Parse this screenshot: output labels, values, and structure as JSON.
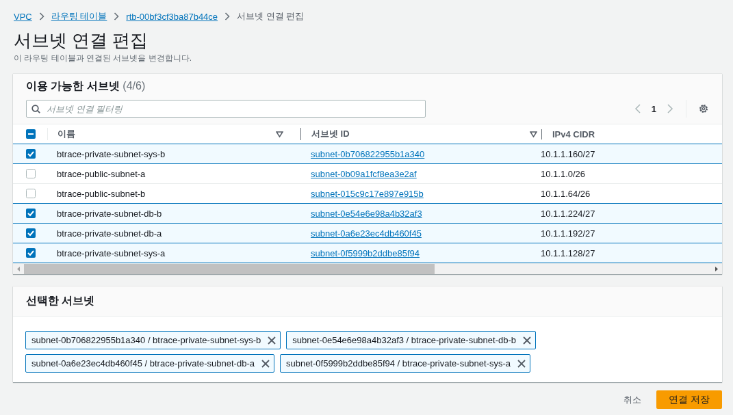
{
  "breadcrumbs": [
    {
      "label": "VPC",
      "kind": "link"
    },
    {
      "label": "라우팅 테이블",
      "kind": "link"
    },
    {
      "label": "rtb-00bf3cf3ba87b44ce",
      "kind": "link"
    },
    {
      "label": "서브넷 연결 편집",
      "kind": "current"
    }
  ],
  "page": {
    "title": "서브넷 연결 편집",
    "description": "이 라우팅 테이블과 연결된 서브넷을 변경합니다."
  },
  "available": {
    "title": "이용 가능한 서브넷",
    "count": "(4/6)",
    "filter": {
      "placeholder": "서브넷 연결 필터링"
    },
    "page": "1",
    "select_all_indeterminate": true,
    "columns": [
      "이름",
      "서브넷 ID",
      "IPv4 CIDR"
    ],
    "rows": [
      {
        "name": "btrace-private-subnet-sys-b",
        "subnet_id": "subnet-0b706822955b1a340",
        "cidr": "10.1.1.160/27",
        "selected": true
      },
      {
        "name": "btrace-public-subnet-a",
        "subnet_id": "subnet-0b09a1fcf8ea3e2af",
        "cidr": "10.1.1.0/26",
        "selected": false
      },
      {
        "name": "btrace-public-subnet-b",
        "subnet_id": "subnet-015c9c17e897e915b",
        "cidr": "10.1.1.64/26",
        "selected": false
      },
      {
        "name": "btrace-private-subnet-db-b",
        "subnet_id": "subnet-0e54e6e98a4b32af3",
        "cidr": "10.1.1.224/27",
        "selected": true
      },
      {
        "name": "btrace-private-subnet-db-a",
        "subnet_id": "subnet-0a6e23ec4db460f45",
        "cidr": "10.1.1.192/27",
        "selected": true
      },
      {
        "name": "btrace-private-subnet-sys-a",
        "subnet_id": "subnet-0f5999b2ddbe85f94",
        "cidr": "10.1.1.128/27",
        "selected": true
      }
    ]
  },
  "selected_subnets": {
    "title": "선택한 서브넷",
    "tokens": [
      "subnet-0b706822955b1a340 / btrace-private-subnet-sys-b",
      "subnet-0e54e6e98a4b32af3 / btrace-private-subnet-db-b",
      "subnet-0a6e23ec4db460f45 / btrace-private-subnet-db-a",
      "subnet-0f5999b2ddbe85f94 / btrace-private-subnet-sys-a"
    ]
  },
  "buttons": [
    {
      "label": "취소",
      "kind": "link"
    },
    {
      "label": "연결 저장",
      "kind": "primary"
    }
  ]
}
